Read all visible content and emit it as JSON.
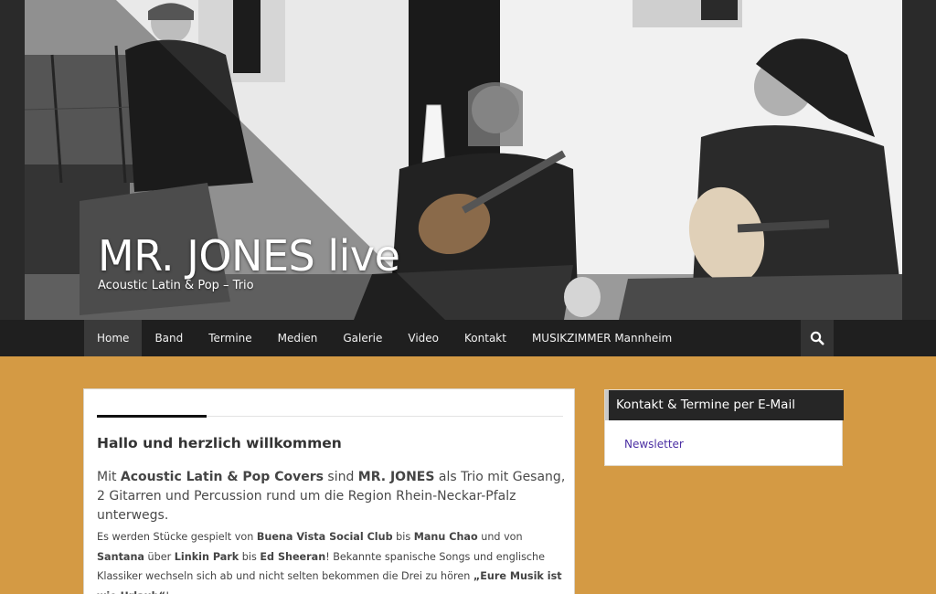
{
  "site": {
    "title": "MR. JONES live",
    "tagline": "Acoustic Latin & Pop – Trio"
  },
  "nav": {
    "items": [
      {
        "label": "Home",
        "active": true
      },
      {
        "label": "Band",
        "active": false
      },
      {
        "label": "Termine",
        "active": false
      },
      {
        "label": "Medien",
        "active": false
      },
      {
        "label": "Galerie",
        "active": false
      },
      {
        "label": "Video",
        "active": false
      },
      {
        "label": "Kontakt",
        "active": false
      },
      {
        "label": "MUSIKZIMMER Mannheim",
        "active": false
      }
    ],
    "search_icon": "search-icon"
  },
  "main": {
    "heading": "Hallo und herzlich willkommen",
    "intro": {
      "t1": "Mit ",
      "b1": "Acoustic Latin & Pop Covers",
      "t2": " sind ",
      "b2": "MR. JONES",
      "t3": " als Trio mit Gesang, 2 Gitarren und Percussion rund um die Region Rhein-Neckar-Pfalz unterwegs."
    },
    "body": {
      "t1": "Es werden Stücke gespielt von ",
      "b1": "Buena Vista Social Club",
      "t2": " bis ",
      "b2": "Manu Chao",
      "t3": " und von ",
      "b3": "Santana",
      "t4": " über ",
      "b4": "Linkin Park",
      "t5": " bis ",
      "b5": "Ed Sheeran",
      "t6": "! Bekannte spanische Songs und englische Klassiker wechseln sich ab und nicht selten bekommen die Drei zu hören ",
      "b6": "„Eure Musik ist wie Urlaub“",
      "t7": "!"
    }
  },
  "sidebar": {
    "widget_title": "Kontakt & Termine per E-Mail",
    "link_label": "Newsletter"
  },
  "colors": {
    "page_background": "#d49a44",
    "nav_background": "#1f1f1f",
    "link": "#4b2fa3"
  }
}
